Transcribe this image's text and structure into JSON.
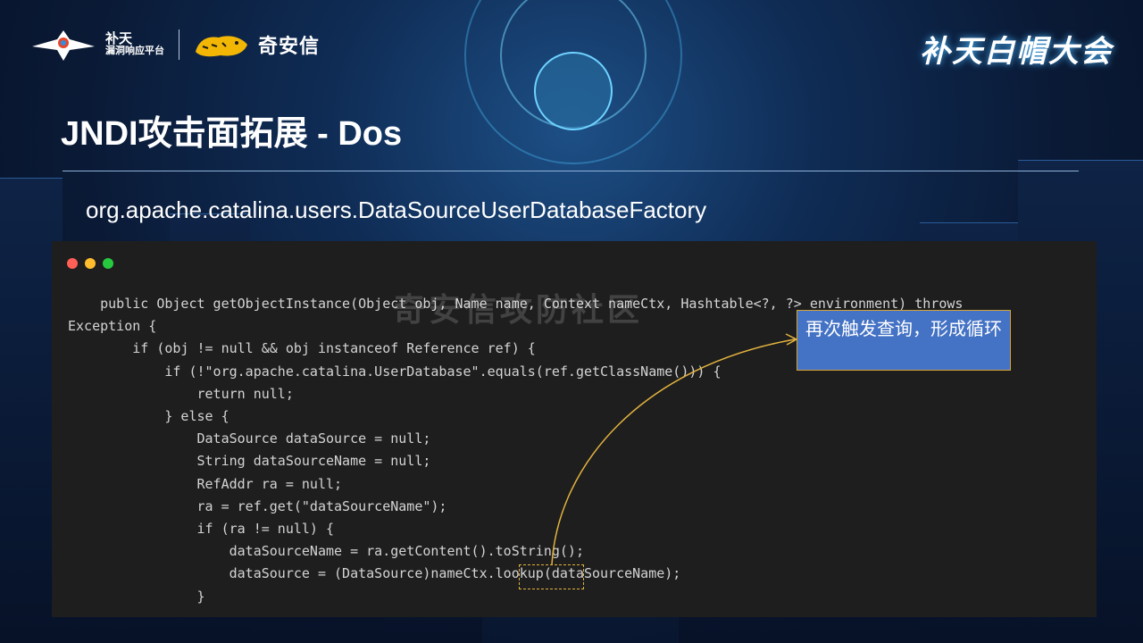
{
  "header": {
    "butian_line1": "补天",
    "butian_line2": "漏洞响应平台",
    "qax_name": "奇安信",
    "brand_right": "补天白帽大会"
  },
  "slide": {
    "title": "JNDI攻击面拓展 - Dos",
    "subtitle": "org.apache.catalina.users.DataSourceUserDatabaseFactory"
  },
  "code": {
    "lines": [
      "    public Object getObjectInstance(Object obj, Name name, Context nameCtx, Hashtable<?, ?> environment) throws",
      "Exception {",
      "        if (obj != null && obj instanceof Reference ref) {",
      "            if (!\"org.apache.catalina.UserDatabase\".equals(ref.getClassName())) {",
      "                return null;",
      "            } else {",
      "                DataSource dataSource = null;",
      "                String dataSourceName = null;",
      "                RefAddr ra = null;",
      "                ra = ref.get(\"dataSourceName\");",
      "                if (ra != null) {",
      "                    dataSourceName = ra.getContent().toString();",
      "                    dataSource = (DataSource)nameCtx.lookup(dataSourceName);",
      "                }"
    ]
  },
  "annotation": {
    "text": "再次触发查询，形成循环"
  },
  "watermark": "奇安信攻防社区",
  "colors": {
    "window_red": "#ff5f56",
    "window_yellow": "#ffbd2e",
    "window_green": "#27c93f",
    "annotation_bg": "#4472c4",
    "highlight_border": "#e3b33e"
  }
}
